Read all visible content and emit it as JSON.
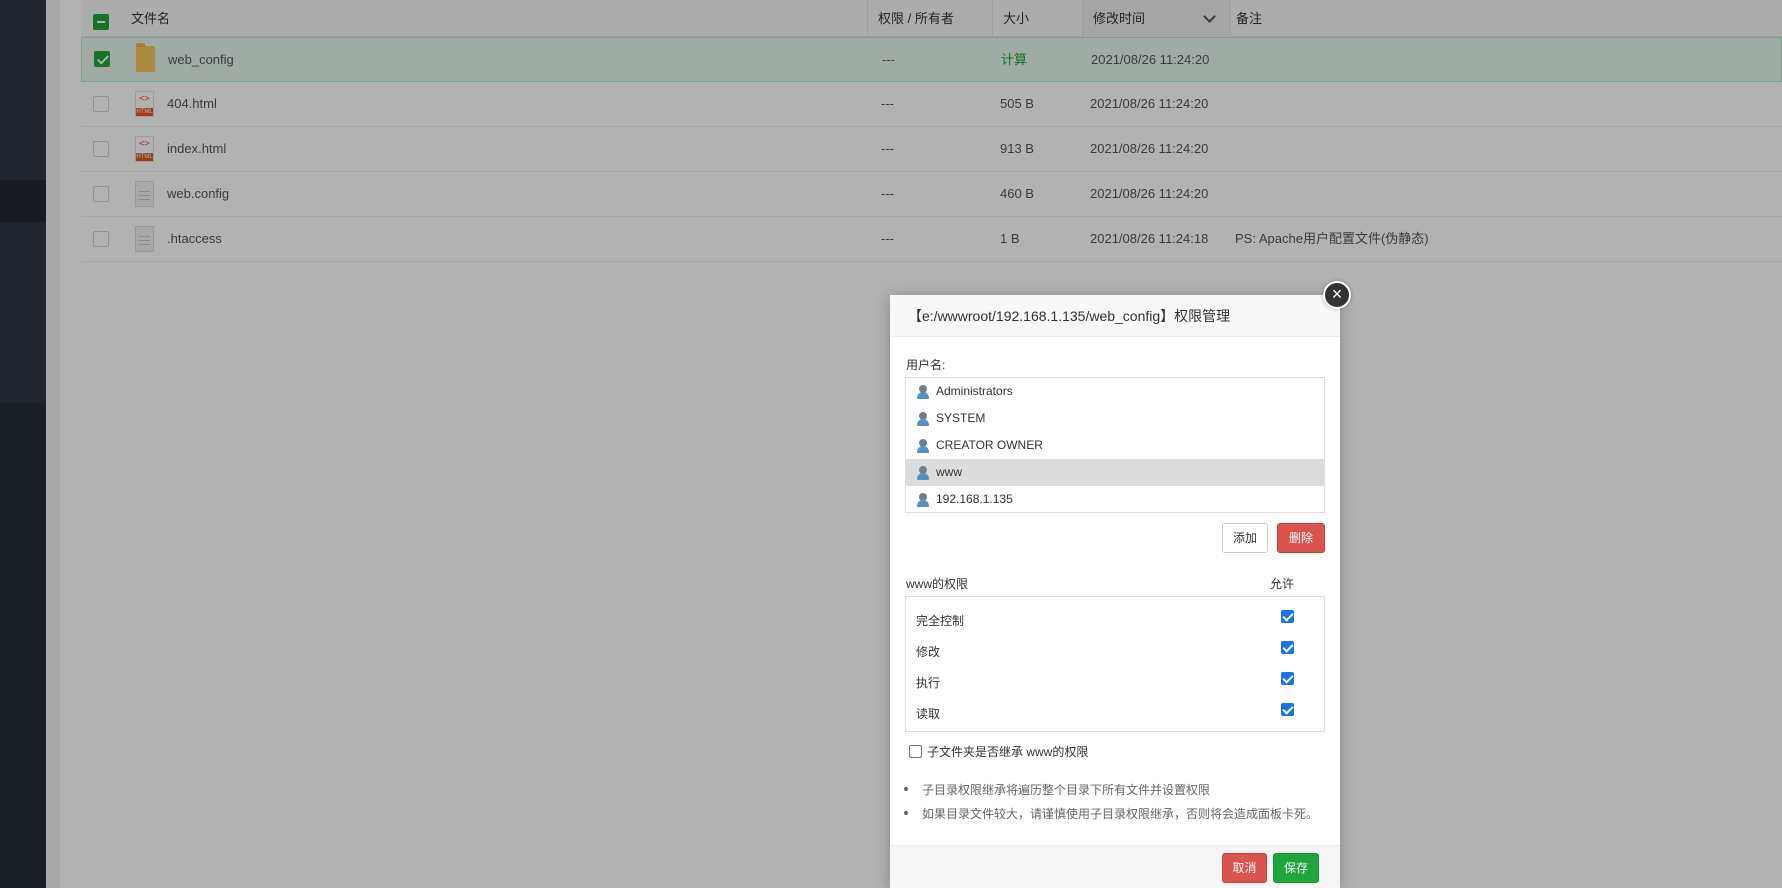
{
  "table": {
    "headers": {
      "name": "文件名",
      "permission": "权限 / 所有者",
      "size": "大小",
      "mtime": "修改时间",
      "note": "备注"
    },
    "rows": [
      {
        "name": "web_config",
        "permission": "---",
        "size": "计算",
        "mtime": "2021/08/26 11:24:20",
        "note": "",
        "icon": "folder-icon",
        "checked": true
      },
      {
        "name": "404.html",
        "permission": "---",
        "size": "505 B",
        "mtime": "2021/08/26 11:24:20",
        "note": "",
        "icon": "html-file-icon",
        "checked": false
      },
      {
        "name": "index.html",
        "permission": "---",
        "size": "913 B",
        "mtime": "2021/08/26 11:24:20",
        "note": "",
        "icon": "html-file-icon",
        "checked": false
      },
      {
        "name": "web.config",
        "permission": "---",
        "size": "460 B",
        "mtime": "2021/08/26 11:24:20",
        "note": "",
        "icon": "file-icon",
        "checked": false
      },
      {
        "name": ".htaccess",
        "permission": "---",
        "size": "1 B",
        "mtime": "2021/08/26 11:24:18",
        "note": "PS: Apache用户配置文件(伪静态)",
        "icon": "file-icon",
        "checked": false
      }
    ],
    "html_badge": "HTML"
  },
  "dialog": {
    "title": "【e:/wwwroot/192.168.1.135/web_config】权限管理",
    "close_glyph": "×",
    "username_label": "用户名:",
    "users": [
      "Administrators",
      "SYSTEM",
      "CREATOR OWNER",
      "www",
      "192.168.1.135"
    ],
    "selected_user": "www",
    "add_label": "添加",
    "delete_label": "删除",
    "perm_title": "www的权限",
    "allow_label": "允许",
    "permissions": [
      {
        "label": "完全控制",
        "allowed": true
      },
      {
        "label": "修改",
        "allowed": true
      },
      {
        "label": "执行",
        "allowed": true
      },
      {
        "label": "读取",
        "allowed": true
      }
    ],
    "inherit_label": "子文件夹是否继承 www的权限",
    "inherit_checked": false,
    "notes": [
      "子目录权限继承将遍历整个目录下所有文件并设置权限",
      "如果目录文件较大，请谨慎使用子目录权限继承，否则将会造成面板卡死。"
    ],
    "cancel_label": "取消",
    "save_label": "保存"
  },
  "colors": {
    "accent_green": "#20a53a",
    "danger_red": "#d9534f",
    "sidebar_dark": "#2f3541"
  }
}
